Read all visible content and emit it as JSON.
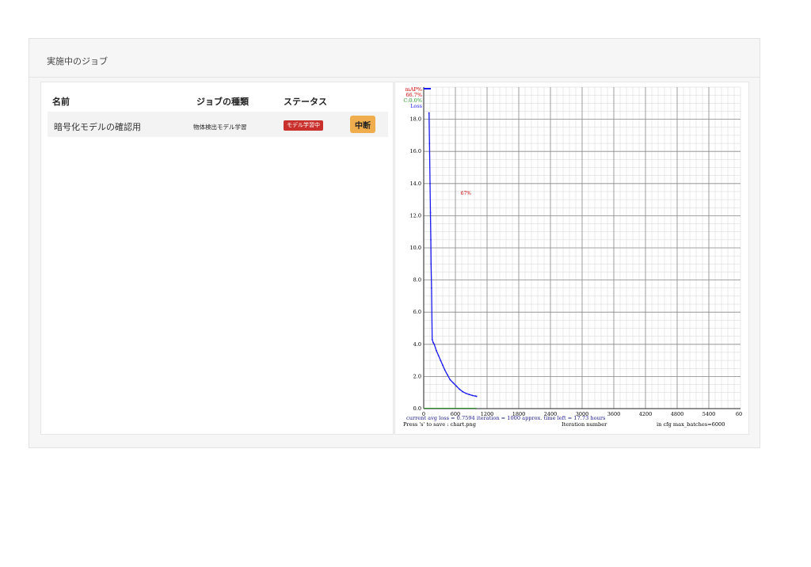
{
  "card": {
    "title": "実施中のジョブ"
  },
  "table": {
    "headers": [
      "名前",
      "ジョブの種類",
      "ステータス"
    ],
    "rows": [
      {
        "name": "暗号化モデルの確認用",
        "type": "物体検出モデル学習",
        "status": "モデル学習中",
        "action": "中断"
      }
    ]
  },
  "colors": {
    "badge": "#c9302c",
    "stop_button": "#efad4e",
    "loss_line": "#1a1af0",
    "map_line": "#cc0000",
    "grid": "#888888"
  },
  "chart_data": {
    "type": "line",
    "legend": {
      "map_label": "mAP%",
      "map_value": "66.7%",
      "c_label": "C:0.0%",
      "loss_label": "Loss"
    },
    "annotation": "67%",
    "xlim": [
      0,
      6000
    ],
    "ylim": [
      0,
      20
    ],
    "x_ticks": [
      0,
      600,
      1200,
      1800,
      2400,
      3000,
      3600,
      4200,
      4800,
      5400
    ],
    "x_tick_labels": [
      "0",
      "600",
      "1200",
      "1800",
      "2400",
      "3000",
      "3600",
      "4200",
      "4800",
      "5400",
      "60"
    ],
    "y_ticks": [
      0,
      2,
      4,
      6,
      8,
      10,
      12,
      14,
      16,
      18
    ],
    "y_tick_labels": [
      "0.0",
      "2.0",
      "4.0",
      "6.0",
      "8.0",
      "10.0",
      "12.0",
      "14.0",
      "16.0",
      "18.0"
    ],
    "status_line1": "current avg loss = 0.7594    iteration = 1000    approx. time left = 17.73 hours",
    "status_line2_left": "Press 's' to save : chart.png",
    "status_line2_mid": "Iteration number",
    "status_line2_right": "in cfg max_batches=6000",
    "series": [
      {
        "name": "Loss",
        "x": [
          100,
          110,
          120,
          128,
          135,
          140,
          148,
          160,
          180,
          200,
          240,
          280,
          320,
          360,
          400,
          450,
          500,
          560,
          620,
          680,
          740,
          800,
          860,
          920,
          980,
          1000
        ],
        "y": [
          18.4,
          16.5,
          14.0,
          12.2,
          10.5,
          9.0,
          7.5,
          4.3,
          4.1,
          4.0,
          3.6,
          3.3,
          3.0,
          2.7,
          2.4,
          2.1,
          1.8,
          1.6,
          1.4,
          1.2,
          1.05,
          0.95,
          0.88,
          0.82,
          0.78,
          0.76
        ]
      },
      {
        "name": "C",
        "x": [
          0,
          1000
        ],
        "y": [
          0,
          0
        ]
      }
    ]
  }
}
